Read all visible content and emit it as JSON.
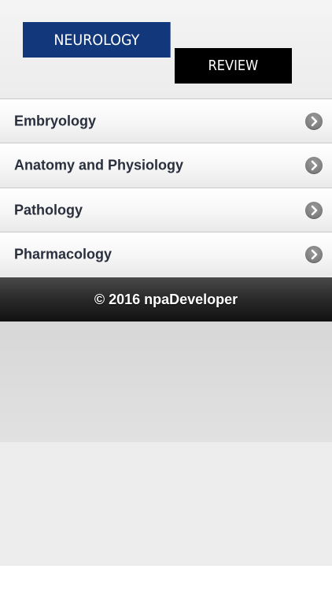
{
  "header": {
    "logo_top": "NEUROLOGY",
    "logo_bottom": "REVIEW",
    "colors": {
      "logo_top_bg": "#12377a",
      "logo_bottom_bg": "#000000"
    }
  },
  "menu": {
    "items": [
      {
        "label": "Embryology",
        "icon": "chevron-right-icon"
      },
      {
        "label": "Anatomy and Physiology",
        "icon": "chevron-right-icon"
      },
      {
        "label": "Pathology",
        "icon": "chevron-right-icon"
      },
      {
        "label": "Pharmacology",
        "icon": "chevron-right-icon"
      }
    ]
  },
  "footer": {
    "text": "© 2016 npaDeveloper"
  }
}
